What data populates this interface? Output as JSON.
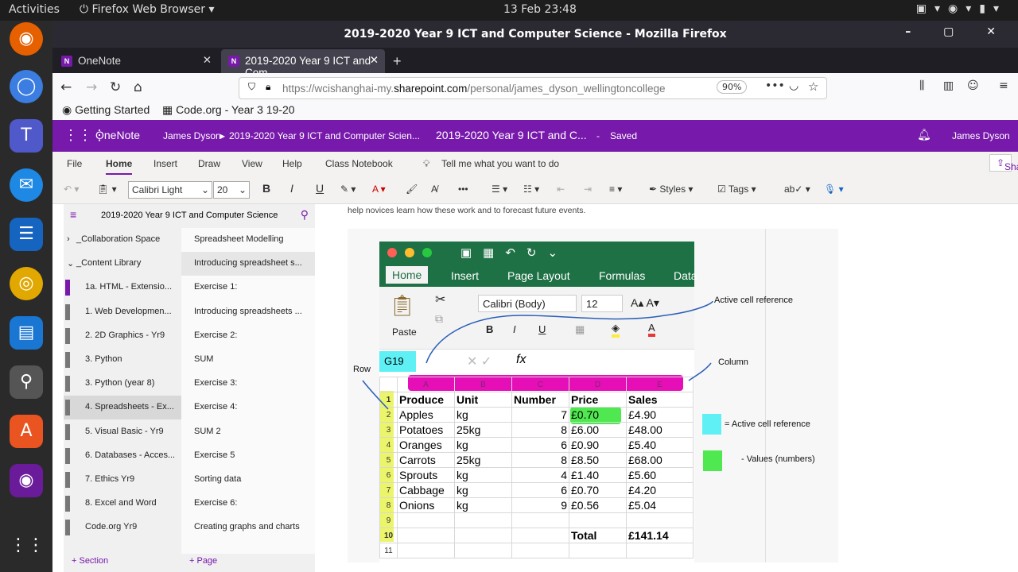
{
  "system": {
    "activities": "Activities",
    "app_menu": "Firefox Web Browser",
    "clock": "13 Feb  23:48"
  },
  "window": {
    "title": "2019-2020 Year 9 ICT and Computer Science - Mozilla Firefox"
  },
  "tabs": [
    {
      "label": "OneNote"
    },
    {
      "label": "2019-2020 Year 9 ICT and Com"
    }
  ],
  "navbar": {
    "url_prefix": "https://wcishanghai-my.",
    "url_domain": "sharepoint.com",
    "url_suffix": "/personal/james_dyson_wellingtoncollege",
    "zoom": "90%"
  },
  "bookmarks": [
    {
      "label": "Getting Started"
    },
    {
      "label": "Code.org - Year 3 19-20"
    }
  ],
  "onenote": {
    "app_name": "OneNote",
    "breadcrumb_user": "James Dyson",
    "breadcrumb_notebook": "2019-2020 Year 9 ICT and Computer Scien...",
    "doc_title": "2019-2020 Year 9 ICT and C...",
    "separator": "-",
    "status": "Saved",
    "user": "James Dyson"
  },
  "menu": {
    "items": [
      "File",
      "Home",
      "Insert",
      "Draw",
      "View",
      "Help",
      "Class Notebook"
    ],
    "tell_me": "Tell me what you want to do",
    "share": "Share"
  },
  "toolbar": {
    "font": "Calibri Light",
    "size": "20",
    "bold": "B",
    "italic": "I",
    "underline": "U",
    "styles": "Styles",
    "tags": "Tags"
  },
  "notebook": {
    "name": "2019-2020 Year 9 ICT and Computer Science"
  },
  "sections": [
    {
      "label": "_Collaboration Space",
      "color": "#f0f0f0"
    },
    {
      "label": "_Content Library",
      "color": "#f0f0f0"
    },
    {
      "label": "1a. HTML - Extensio...",
      "color": "#7719aa"
    },
    {
      "label": "1. Web Developmen...",
      "color": "#777777"
    },
    {
      "label": "2. 2D Graphics - Yr9",
      "color": "#777777"
    },
    {
      "label": "3. Python",
      "color": "#777777"
    },
    {
      "label": "3. Python (year 8)",
      "color": "#777777"
    },
    {
      "label": "4. Spreadsheets - Ex...",
      "color": "#777777"
    },
    {
      "label": "5. Visual Basic - Yr9",
      "color": "#777777"
    },
    {
      "label": "6. Databases - Acces...",
      "color": "#777777"
    },
    {
      "label": "7. Ethics Yr9",
      "color": "#777777"
    },
    {
      "label": "8. Excel and Word",
      "color": "#777777"
    },
    {
      "label": "Code.org Yr9",
      "color": "#777777"
    }
  ],
  "pages": [
    "Spreadsheet Modelling",
    "Introducing spreadsheet s...",
    "Exercise 1:",
    "Introducing spreadsheets ...",
    "Exercise 2:",
    "SUM",
    "Exercise 3:",
    "Exercise 4:",
    "SUM 2",
    "Exercise 5",
    "Sorting data",
    "Exercise 6:",
    "Creating graphs and charts"
  ],
  "footer": {
    "add_section": "+ Section",
    "add_page": "+ Page"
  },
  "canvas": {
    "hint_text": "help novices learn how these work and to forecast future events.",
    "excel": {
      "tabs": [
        "Home",
        "Insert",
        "Page Layout",
        "Formulas",
        "Data"
      ],
      "font": "Calibri (Body)",
      "size": "12",
      "paste": "Paste",
      "cell_ref": "G19",
      "fx": "fx",
      "columns": [
        "A",
        "B",
        "C",
        "D",
        "E"
      ],
      "headers": [
        "Produce",
        "Unit",
        "Number",
        "Price",
        "Sales"
      ],
      "rows": [
        [
          "Apples",
          "kg",
          "7",
          "£0.70",
          "£4.90"
        ],
        [
          "Potatoes",
          "25kg",
          "8",
          "£6.00",
          "£48.00"
        ],
        [
          "Oranges",
          "kg",
          "6",
          "£0.90",
          "£5.40"
        ],
        [
          "Carrots",
          "25kg",
          "8",
          "£8.50",
          "£68.00"
        ],
        [
          "Sprouts",
          "kg",
          "4",
          "£1.40",
          "£5.60"
        ],
        [
          "Cabbage",
          "kg",
          "6",
          "£0.70",
          "£4.20"
        ],
        [
          "Onions",
          "kg",
          "9",
          "£0.56",
          "£5.04"
        ]
      ],
      "total_label": "Total",
      "total_value": "£141.14"
    },
    "annotations": {
      "active_cell": "Active cell reference",
      "column": "Column",
      "row": "Row",
      "legend_active": "= Active cell reference",
      "legend_values": "-    Values (numbers)"
    }
  }
}
